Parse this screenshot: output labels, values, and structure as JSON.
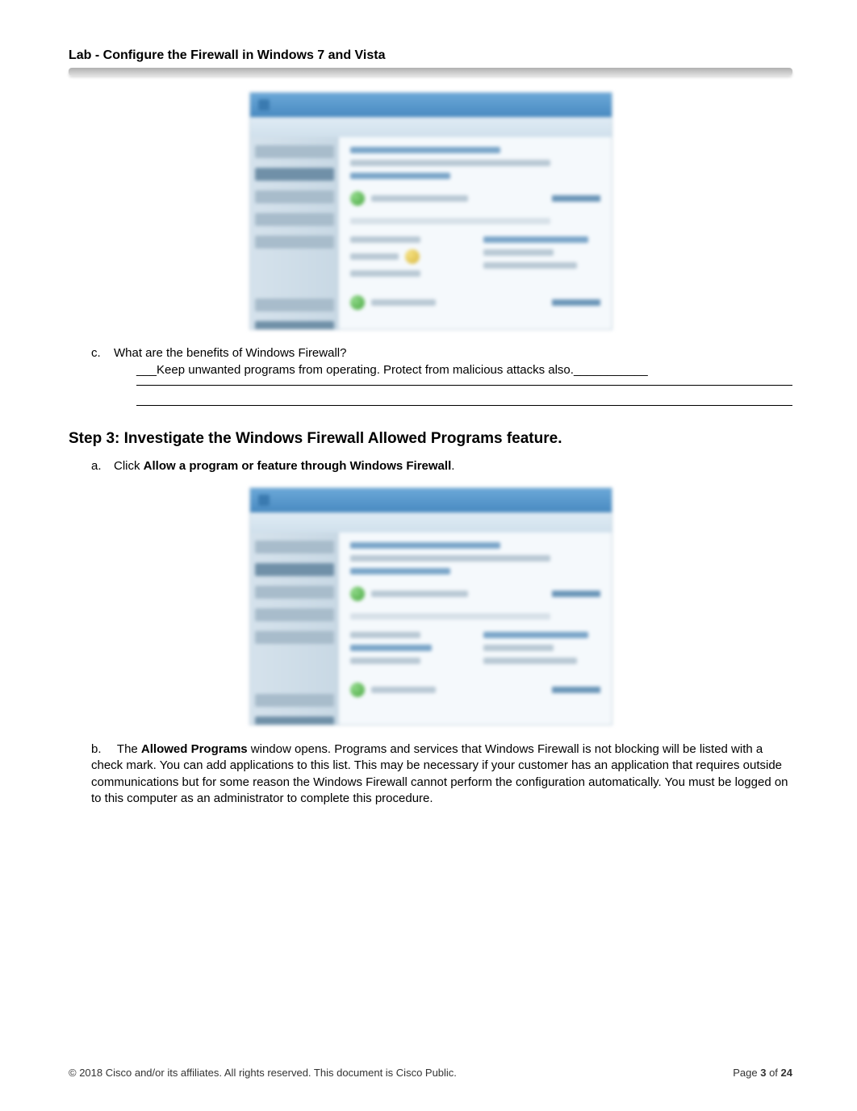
{
  "header": {
    "title": "Lab - Configure the Firewall in Windows 7 and Vista"
  },
  "question_c": {
    "letter": "c.",
    "text": "What are the benefits of Windows Firewall?",
    "answer_prefix": "___",
    "answer": "Keep unwanted programs from operating. Protect from malicious attacks also.",
    "answer_suffix": "___________"
  },
  "step3": {
    "heading": "Step 3: Investigate the Windows Firewall Allowed Programs feature.",
    "item_a": {
      "letter": "a.",
      "prefix": "Click ",
      "bold": "Allow a program or feature through Windows Firewall",
      "suffix": "."
    },
    "item_b": {
      "letter": "b.",
      "prefix": "The ",
      "bold": "Allowed Programs",
      "rest": " window opens. Programs and services that Windows Firewall is not blocking will be listed with a check mark. You can add applications to this list. This may be necessary if your customer has an application that requires outside communications but for some reason the Windows Firewall cannot perform the configuration automatically. You must be logged on to this computer as an administrator to complete this procedure."
    }
  },
  "footer": {
    "left": "© 2018 Cisco and/or its affiliates. All rights reserved. This document is Cisco Public.",
    "page_label": "Page ",
    "page_num": "3",
    "of": " of ",
    "total": "24"
  }
}
